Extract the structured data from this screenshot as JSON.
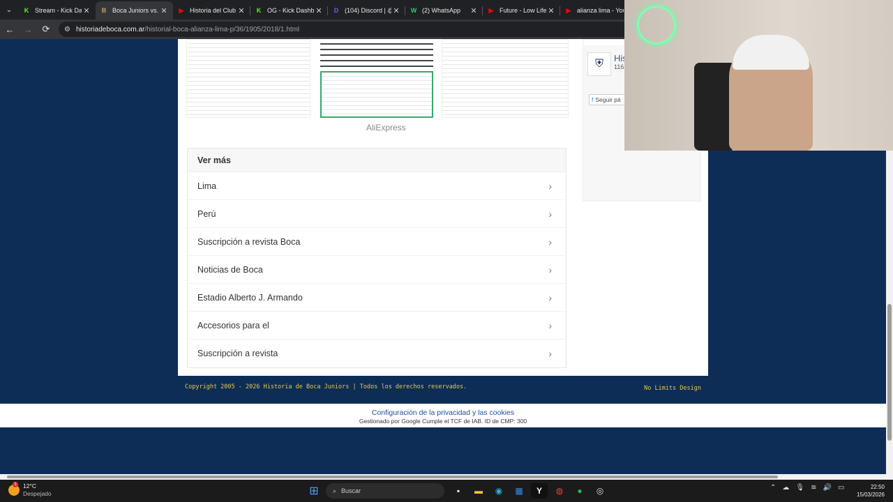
{
  "tabs": [
    {
      "title": "Stream - Kick Dashboard",
      "favicon": "K",
      "color": "#53fc18"
    },
    {
      "title": "Boca Juniors vs. Alianza",
      "favicon": "B",
      "color": "#c8a060"
    },
    {
      "title": "Historia del Club Alianza",
      "favicon": "▶",
      "color": "#ff0000"
    },
    {
      "title": "OG - Kick Dashboard",
      "favicon": "K",
      "color": "#53fc18"
    },
    {
      "title": "(104) Discord | @",
      "favicon": "D",
      "color": "#5865f2"
    },
    {
      "title": "(2) WhatsApp",
      "favicon": "W",
      "color": "#25d366"
    },
    {
      "title": "Future - Low Life",
      "favicon": "▶",
      "color": "#ff0000"
    },
    {
      "title": "alianza lima - YouTube",
      "favicon": "▶",
      "color": "#ff0000"
    }
  ],
  "address": {
    "host": "historiadeboca.com.ar",
    "path": "/historial-boca-alianza-lima-p/36/1905/2018/1.html"
  },
  "ad": {
    "source": "AliExpress"
  },
  "ver_mas": {
    "heading": "Ver más",
    "items": [
      "Lima",
      "Perú",
      "Suscripción a revista Boca",
      "Noticias de Boca",
      "Estadio Alberto J. Armando",
      "Accesorios para el",
      "Suscripción a revista"
    ]
  },
  "sidebar": {
    "page_name": "His",
    "count": "116",
    "follow": "Seguir pá"
  },
  "footer": {
    "copyright": "Copyright 2005 - 2026 Historia de Boca Juniors | Todos los derechos reservados.",
    "credit": "No Limits Design"
  },
  "consent": {
    "link": "Configuración de la privacidad y las cookies",
    "sub": "Gestionado por Google Cumple el TCF de IAB. ID de CMP: 300"
  },
  "taskbar": {
    "temp": "12°C",
    "condition": "Despejado",
    "search": "Buscar",
    "time": "22:50",
    "date": "15/03/2026"
  }
}
